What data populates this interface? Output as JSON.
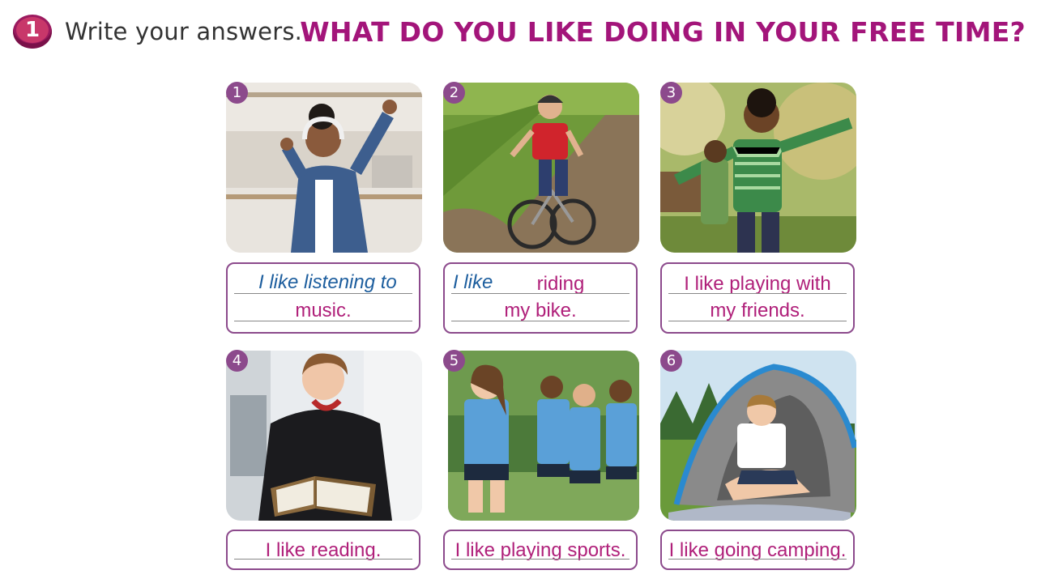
{
  "exercise": {
    "number": "1",
    "instruction": "Write your answers.",
    "title": "WHAT DO YOU LIKE DOING IN YOUR FREE TIME?"
  },
  "items": [
    {
      "number": "1",
      "prompt": "I like listening to",
      "answer_line1": "",
      "answer_line2": "music.",
      "image_icon": "girl-dancing-headphones"
    },
    {
      "number": "2",
      "prompt": "I like",
      "answer_line1": "riding",
      "answer_line2": "my bike.",
      "image_icon": "boy-riding-bike"
    },
    {
      "number": "3",
      "prompt": "",
      "answer_line1": "I like playing with",
      "answer_line2": "my friends.",
      "image_icon": "boys-playing-outdoors"
    },
    {
      "number": "4",
      "prompt": "",
      "answer_line1": "I like reading.",
      "answer_line2": "",
      "image_icon": "teen-reading-book"
    },
    {
      "number": "5",
      "prompt": "",
      "answer_line1": "I like playing sports.",
      "answer_line2": "",
      "image_icon": "girls-playing-soccer"
    },
    {
      "number": "6",
      "prompt": "",
      "answer_line1": "I like going camping.",
      "answer_line2": "",
      "image_icon": "boy-in-tent"
    }
  ],
  "colors": {
    "title": "#a3157a",
    "answer": "#b0207a",
    "prompt": "#1d5e9e",
    "frame": "#8c4a8c"
  }
}
